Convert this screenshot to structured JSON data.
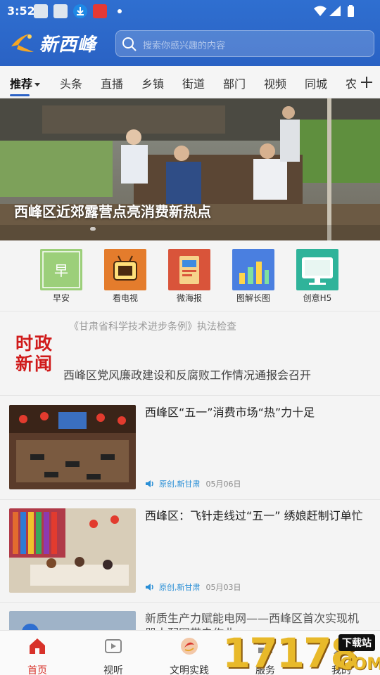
{
  "status_bar": {
    "time": "3:52"
  },
  "header": {
    "app_name": "新西峰",
    "search_placeholder": "搜索你感兴趣的内容"
  },
  "tabs": [
    "推荐",
    "头条",
    "直播",
    "乡镇",
    "街道",
    "部门",
    "视频",
    "同城",
    "农"
  ],
  "banner": {
    "title": "西峰区近郊露营点亮消费新热点"
  },
  "quick_entries": [
    {
      "label": "早安",
      "icon": "morning-icon"
    },
    {
      "label": "看电视",
      "icon": "tv-icon"
    },
    {
      "label": "微海报",
      "icon": "poster-icon"
    },
    {
      "label": "图解长图",
      "icon": "infographic-icon"
    },
    {
      "label": "创意H5",
      "icon": "h5-icon"
    }
  ],
  "politics": {
    "logo_line1": "时政",
    "logo_line2": "新闻",
    "faded_headline": "《甘肃省科学技术进步条例》执法检查",
    "headline": "西峰区党风廉政建设和反腐败工作情况通报会召开"
  },
  "news": [
    {
      "title": "西峰区“五一”消费市场“热”力十足",
      "source": "原创,新甘肃",
      "date": "05月06日"
    },
    {
      "title": "西峰区：飞针走线过“五一” 绣娘赶制订单忙",
      "source": "原创,新甘肃",
      "date": "05月03日"
    },
    {
      "title": "新质生产力赋能电网——西峰区首次实现机器人配网带电作业",
      "source": "",
      "date": ""
    }
  ],
  "bottom_nav": [
    {
      "label": "首页",
      "icon": "home-icon",
      "active": true
    },
    {
      "label": "视听",
      "icon": "video-icon",
      "active": false
    },
    {
      "label": "文明实践",
      "icon": "civilization-icon",
      "active": false
    },
    {
      "label": "服务",
      "icon": "service-icon",
      "active": false
    },
    {
      "label": "我的",
      "icon": "profile-icon",
      "active": false
    }
  ],
  "watermark": {
    "number": "17178",
    "badge": "下载站",
    "suffix": ".COM"
  },
  "colors": {
    "brand_blue": "#2d63c6",
    "accent_red": "#d01a1a",
    "link_blue": "#2a8fd6"
  }
}
